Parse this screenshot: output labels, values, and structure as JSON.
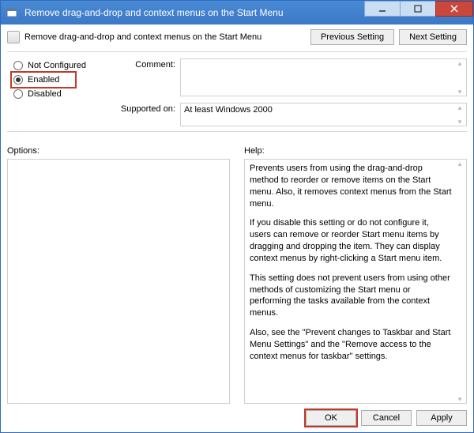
{
  "window": {
    "title": "Remove drag-and-drop and context menus on the Start Menu"
  },
  "header": {
    "policy_name": "Remove drag-and-drop and context menus on the Start Menu",
    "previous_btn": "Previous Setting",
    "next_btn": "Next Setting"
  },
  "state": {
    "not_configured": "Not Configured",
    "enabled": "Enabled",
    "disabled": "Disabled",
    "selected": "enabled"
  },
  "comment": {
    "label": "Comment:",
    "value": ""
  },
  "supported": {
    "label": "Supported on:",
    "value": "At least Windows 2000"
  },
  "options": {
    "label": "Options:"
  },
  "help": {
    "label": "Help:",
    "p1": "Prevents users from using the drag-and-drop method to reorder or remove items on the Start menu. Also, it removes context menus from the Start menu.",
    "p2": "If you disable this setting or do not configure it, users can remove or reorder Start menu items by dragging and dropping the item. They can display context menus by right-clicking a Start menu item.",
    "p3": "This setting does not prevent users from using other methods of customizing the Start menu or performing the tasks available from the context menus.",
    "p4": "Also, see the \"Prevent changes to Taskbar and Start Menu Settings\" and the \"Remove access to the context menus for taskbar\" settings."
  },
  "footer": {
    "ok": "OK",
    "cancel": "Cancel",
    "apply": "Apply"
  }
}
